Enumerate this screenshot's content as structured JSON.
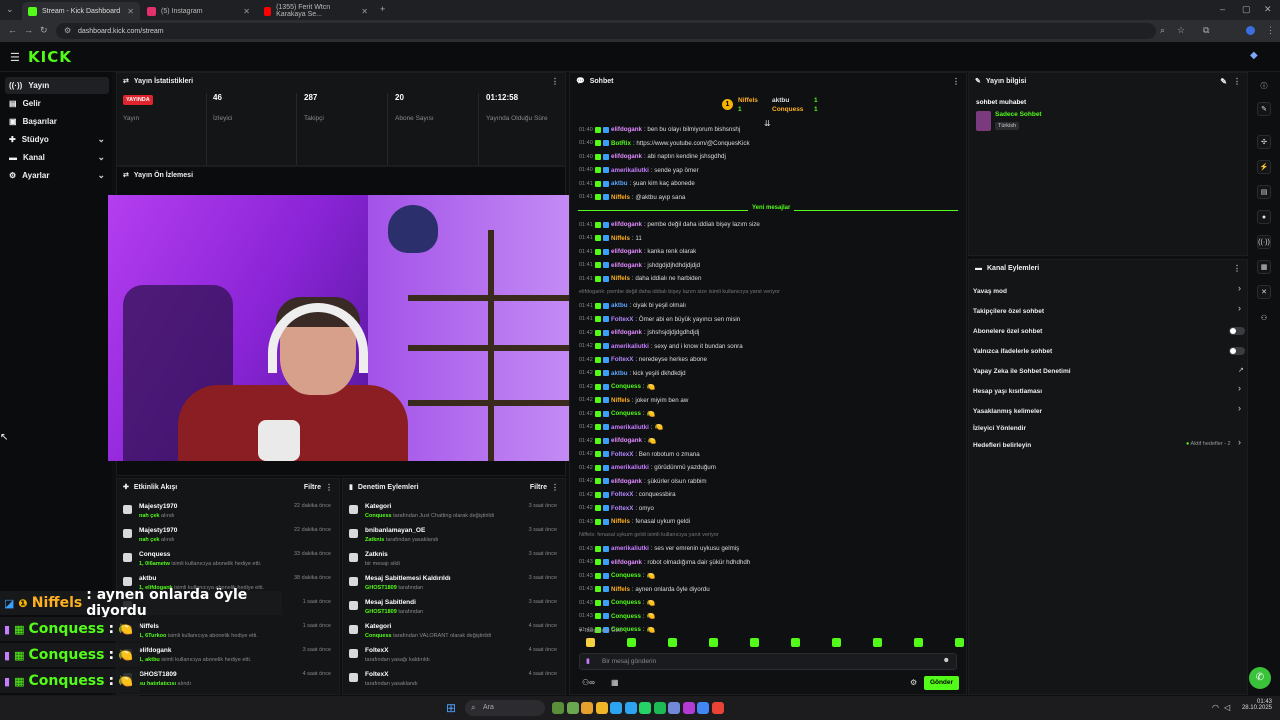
{
  "browser": {
    "tabs": [
      {
        "title": "Stream - Kick Dashboard",
        "color": "#53fc18"
      },
      {
        "title": "(5) Instagram",
        "color": "#e1306c"
      },
      {
        "title": "(1355) Ferit Wtcn Karakaya Se...",
        "color": "#ff0000"
      }
    ],
    "url": "dashboard.kick.com/stream"
  },
  "app": {
    "logo": "KICK",
    "accent": "#53fc18"
  },
  "sidebar": {
    "items": [
      {
        "label": "Yayın",
        "icon": "broadcast-icon"
      },
      {
        "label": "Gelir",
        "icon": "revenue-icon"
      },
      {
        "label": "Başarılar",
        "icon": "achievements-icon"
      },
      {
        "label": "Stüdyo",
        "icon": "studio-icon"
      },
      {
        "label": "Kanal",
        "icon": "channel-icon"
      },
      {
        "label": "Ayarlar",
        "icon": "settings-icon"
      }
    ]
  },
  "stats": {
    "title": "Yayın İstatistikleri",
    "live_badge": "YAYINDA",
    "items": [
      {
        "value": "",
        "label": "Yayın"
      },
      {
        "value": "46",
        "label": "İzleyici"
      },
      {
        "value": "287",
        "label": "Takipçi"
      },
      {
        "value": "20",
        "label": "Abone Sayısı"
      },
      {
        "value": "01:12:58",
        "label": "Yayında Olduğu Süre"
      }
    ]
  },
  "preview": {
    "title": "Yayın Ön İzlemesi"
  },
  "activity": {
    "title": "Etkinlik Akışı",
    "filter": "Filtre",
    "rows": [
      {
        "name": "Majesty1970",
        "sub_em": "nah çek",
        "sub": " alındı",
        "time": "22 dakika önce"
      },
      {
        "name": "Majesty1970",
        "sub_em": "nah çek",
        "sub": " alındı",
        "time": "22 dakika önce"
      },
      {
        "name": "Conquess",
        "sub_em": "1, 0i6ametw",
        "sub": " isimli kullanıcıya abonelik hediye etti.",
        "time": "33 dakika önce"
      },
      {
        "name": "aktbu",
        "sub_em": "1, elifdogank",
        "sub": " isimli kullanıcıya abonelik hediye etti.",
        "time": "38 dakika önce"
      },
      {
        "name": "",
        "sub_em": "",
        "sub": "",
        "time": "1 saat önce"
      },
      {
        "name": "Niffels",
        "sub_em": "1, 6Turkoo",
        "sub": " isimli kullanıcıya abonelik hediye etti.",
        "time": "1 saat önce"
      },
      {
        "name": "elifdogank",
        "sub_em": "1, aktbu",
        "sub": " isimli kullanıcıya abonelik hediye etti.",
        "time": "3 saat önce"
      },
      {
        "name": "GHOST1809",
        "sub_em": "su hatırlatıcısı",
        "sub": " alındı",
        "time": "4 saat önce"
      }
    ]
  },
  "moderation": {
    "title": "Denetim Eylemleri",
    "filter": "Filtre",
    "rows": [
      {
        "name": "Kategori",
        "sub_em": "Conquess",
        "sub": " tarafından Just Chatting olarak değiştirildi",
        "time": "3 saat önce"
      },
      {
        "name": "bnibanlamayan_OE",
        "sub_em": "Zatknis",
        "sub": " tarafından yasaklandı",
        "time": "3 saat önce"
      },
      {
        "name": "Zatknis",
        "sub_em": "",
        "sub": "bir mesajı sildi",
        "time": "3 saat önce"
      },
      {
        "name": "Mesaj Sabitlemesi Kaldırıldı",
        "sub_em": "GHOST1809",
        "sub": " tarafından",
        "time": "3 saat önce"
      },
      {
        "name": "Mesaj Sabitlendi",
        "sub_em": "GHOST1809",
        "sub": " tarafından",
        "time": "3 saat önce"
      },
      {
        "name": "Kategori",
        "sub_em": "Conquess",
        "sub": " tarafından VALORANT olarak değiştirildi",
        "time": "4 saat önce"
      },
      {
        "name": "FoltexX",
        "sub_em": "",
        "sub": "tarafından yasağı kaldırıldı",
        "time": "4 saat önce"
      },
      {
        "name": "FoltexX",
        "sub_em": "",
        "sub": "tarafından yasaklandı",
        "time": "4 saat önce"
      }
    ]
  },
  "chat": {
    "title": "Sohbet",
    "leaderboard": [
      {
        "name": "Niffels",
        "count": "1"
      },
      {
        "name": "aktbu",
        "count": "1"
      },
      {
        "name": "Conquess",
        "count": "1"
      }
    ],
    "new_messages": "Yeni mesajlar",
    "followers_label": "Takipçilere Özel",
    "input_placeholder": "Bir mesaj gönderin",
    "send_label": "Gönder",
    "messages": [
      {
        "t": "01:40",
        "user": "elifdogank",
        "color": "#e08cff",
        "text": ": ben bu olayı bilmiyorum bishsnshj"
      },
      {
        "t": "01:40",
        "user": "BotRix",
        "color": "#53fc18",
        "text": ": https://www.youtube.com/@ConquesKick"
      },
      {
        "t": "01:40",
        "user": "elifdogank",
        "color": "#e08cff",
        "text": ": abi naptın kendine jshsgdhdj"
      },
      {
        "t": "01:40",
        "user": "amerikaliutki",
        "color": "#c77dff",
        "text": ": sende yap ömer"
      },
      {
        "t": "01:41",
        "user": "aktbu",
        "color": "#5aa7ff",
        "text": ": şuan kim kaç abonede"
      },
      {
        "t": "01:41",
        "user": "Niffels",
        "color": "#ffb020",
        "text": ": @aktbu ayıp sana"
      },
      {
        "t": "01:41",
        "user": "elifdogank",
        "color": "#e08cff",
        "text": ": pembe değil daha iddialı bişey lazım size"
      },
      {
        "t": "01:41",
        "user": "Niffels",
        "color": "#ffb020",
        "text": ": 11"
      },
      {
        "t": "01:41",
        "user": "elifdogank",
        "color": "#e08cff",
        "text": ": kanka renk olarak"
      },
      {
        "t": "01:41",
        "user": "elifdogank",
        "color": "#e08cff",
        "text": ": jshdgdjdjhdhdjdjdjd"
      },
      {
        "t": "01:41",
        "user": "Niffels",
        "color": "#ffb020",
        "text": ": daha iddialı ne harbiden"
      },
      {
        "t": "",
        "user": "",
        "color": "#777",
        "text": "elifdogank: pembe değil daha iddialı bişey lazım size isimli kullanıcıya yanıt veriyor"
      },
      {
        "t": "01:41",
        "user": "aktbu",
        "color": "#5aa7ff",
        "text": ": ciyak bi yeşil olmalı"
      },
      {
        "t": "01:41",
        "user": "FoltexX",
        "color": "#b388ff",
        "text": ": Ömer abi en büyük yayıncı sen misin"
      },
      {
        "t": "01:42",
        "user": "elifdogank",
        "color": "#e08cff",
        "text": ": jshshsjdjdjdgdhdjdj"
      },
      {
        "t": "01:42",
        "user": "amerikaliutki",
        "color": "#c77dff",
        "text": ": sexy and i know it bundan sonra"
      },
      {
        "t": "01:42",
        "user": "FoltexX",
        "color": "#b388ff",
        "text": ": neredeyse herkes abone"
      },
      {
        "t": "01:42",
        "user": "aktbu",
        "color": "#5aa7ff",
        "text": ": kick yeşili dkhdkdjd"
      },
      {
        "t": "01:42",
        "user": "Conquess",
        "color": "#53fc18",
        "text": ":"
      },
      {
        "t": "01:42",
        "user": "Niffels",
        "color": "#ffb020",
        "text": ": joker miyim ben aw"
      },
      {
        "t": "01:42",
        "user": "Conquess",
        "color": "#53fc18",
        "text": ":"
      },
      {
        "t": "01:42",
        "user": "amerikaliutki",
        "color": "#c77dff",
        "text": ":"
      },
      {
        "t": "01:42",
        "user": "elifdogank",
        "color": "#e08cff",
        "text": ":"
      },
      {
        "t": "01:42",
        "user": "FoltexX",
        "color": "#b388ff",
        "text": ": Ben robotum o zmana"
      },
      {
        "t": "01:42",
        "user": "amerikaliutki",
        "color": "#c77dff",
        "text": ": görüdünmü yazduğum"
      },
      {
        "t": "01:42",
        "user": "elifdogank",
        "color": "#e08cff",
        "text": ": şükürler olsun rabbim"
      },
      {
        "t": "01:42",
        "user": "FoltexX",
        "color": "#b388ff",
        "text": ": conquessbira"
      },
      {
        "t": "01:42",
        "user": "FoltexX",
        "color": "#b388ff",
        "text": ": omyo"
      },
      {
        "t": "01:43",
        "user": "Niffels",
        "color": "#ffb020",
        "text": ": fenasal uykum geldi"
      },
      {
        "t": "",
        "user": "",
        "color": "#777",
        "text": "Niffels: fenasal uykum geldi isimli kullanıcıya yanıt veriyor"
      },
      {
        "t": "01:43",
        "user": "amerikaliutki",
        "color": "#c77dff",
        "text": ": ses ver emrenin uykusu gelmiş"
      },
      {
        "t": "01:43",
        "user": "elifdogank",
        "color": "#e08cff",
        "text": ": robot olmadığıma dair şükür hdhdhdh"
      },
      {
        "t": "01:43",
        "user": "Conquess",
        "color": "#53fc18",
        "text": ":"
      },
      {
        "t": "01:43",
        "user": "Niffels",
        "color": "#ffb020",
        "text": ": aynen onlarda öyle diyordu"
      },
      {
        "t": "01:43",
        "user": "Conquess",
        "color": "#53fc18",
        "text": ":"
      },
      {
        "t": "01:43",
        "user": "Conquess",
        "color": "#53fc18",
        "text": ":"
      },
      {
        "t": "01:43",
        "user": "Conquess",
        "color": "#53fc18",
        "text": ":"
      }
    ]
  },
  "stream_info": {
    "title": "Yayın bilgisi",
    "stream_title": "sohbet muhabet",
    "category": "Sadece Sohbet",
    "language": "Türkish"
  },
  "channel_actions": {
    "title": "Kanal Eylemleri",
    "items": [
      {
        "label": "Yavaş mod",
        "kind": "chevron"
      },
      {
        "label": "Takipçilere özel sohbet",
        "kind": "chevron"
      },
      {
        "label": "Abonelere özel sohbet",
        "kind": "toggle"
      },
      {
        "label": "Yalnızca ifadelerle sohbet",
        "kind": "toggle"
      },
      {
        "label": "Yapay Zeka ile Sohbet Denetimi",
        "kind": "external"
      },
      {
        "label": "Hesap yaşı kısıtlaması",
        "kind": "chevron"
      },
      {
        "label": "Yasaklanmış kelimeler",
        "kind": "chevron"
      },
      {
        "label": "İzleyici Yönlendir",
        "kind": "none"
      },
      {
        "label": "Hedefleri belirleyin",
        "kind": "goal"
      }
    ],
    "goal_status": "Aktif hedefler - 2"
  },
  "overlay": {
    "rows": [
      {
        "user": "Niffels",
        "color": "#ffb020",
        "text": " : aynen onlarda öyle diyordu"
      },
      {
        "user": "Conquess",
        "color": "#53fc18",
        "text": " :"
      },
      {
        "user": "Conquess",
        "color": "#53fc18",
        "text": " :"
      },
      {
        "user": "Conquess",
        "color": "#53fc18",
        "text": " :"
      },
      {
        "user": "Conquess",
        "color": "#53fc18",
        "text": " :"
      }
    ]
  },
  "taskbar": {
    "search_placeholder": "Ara",
    "time": "01:43",
    "date": "28.10.2025"
  }
}
